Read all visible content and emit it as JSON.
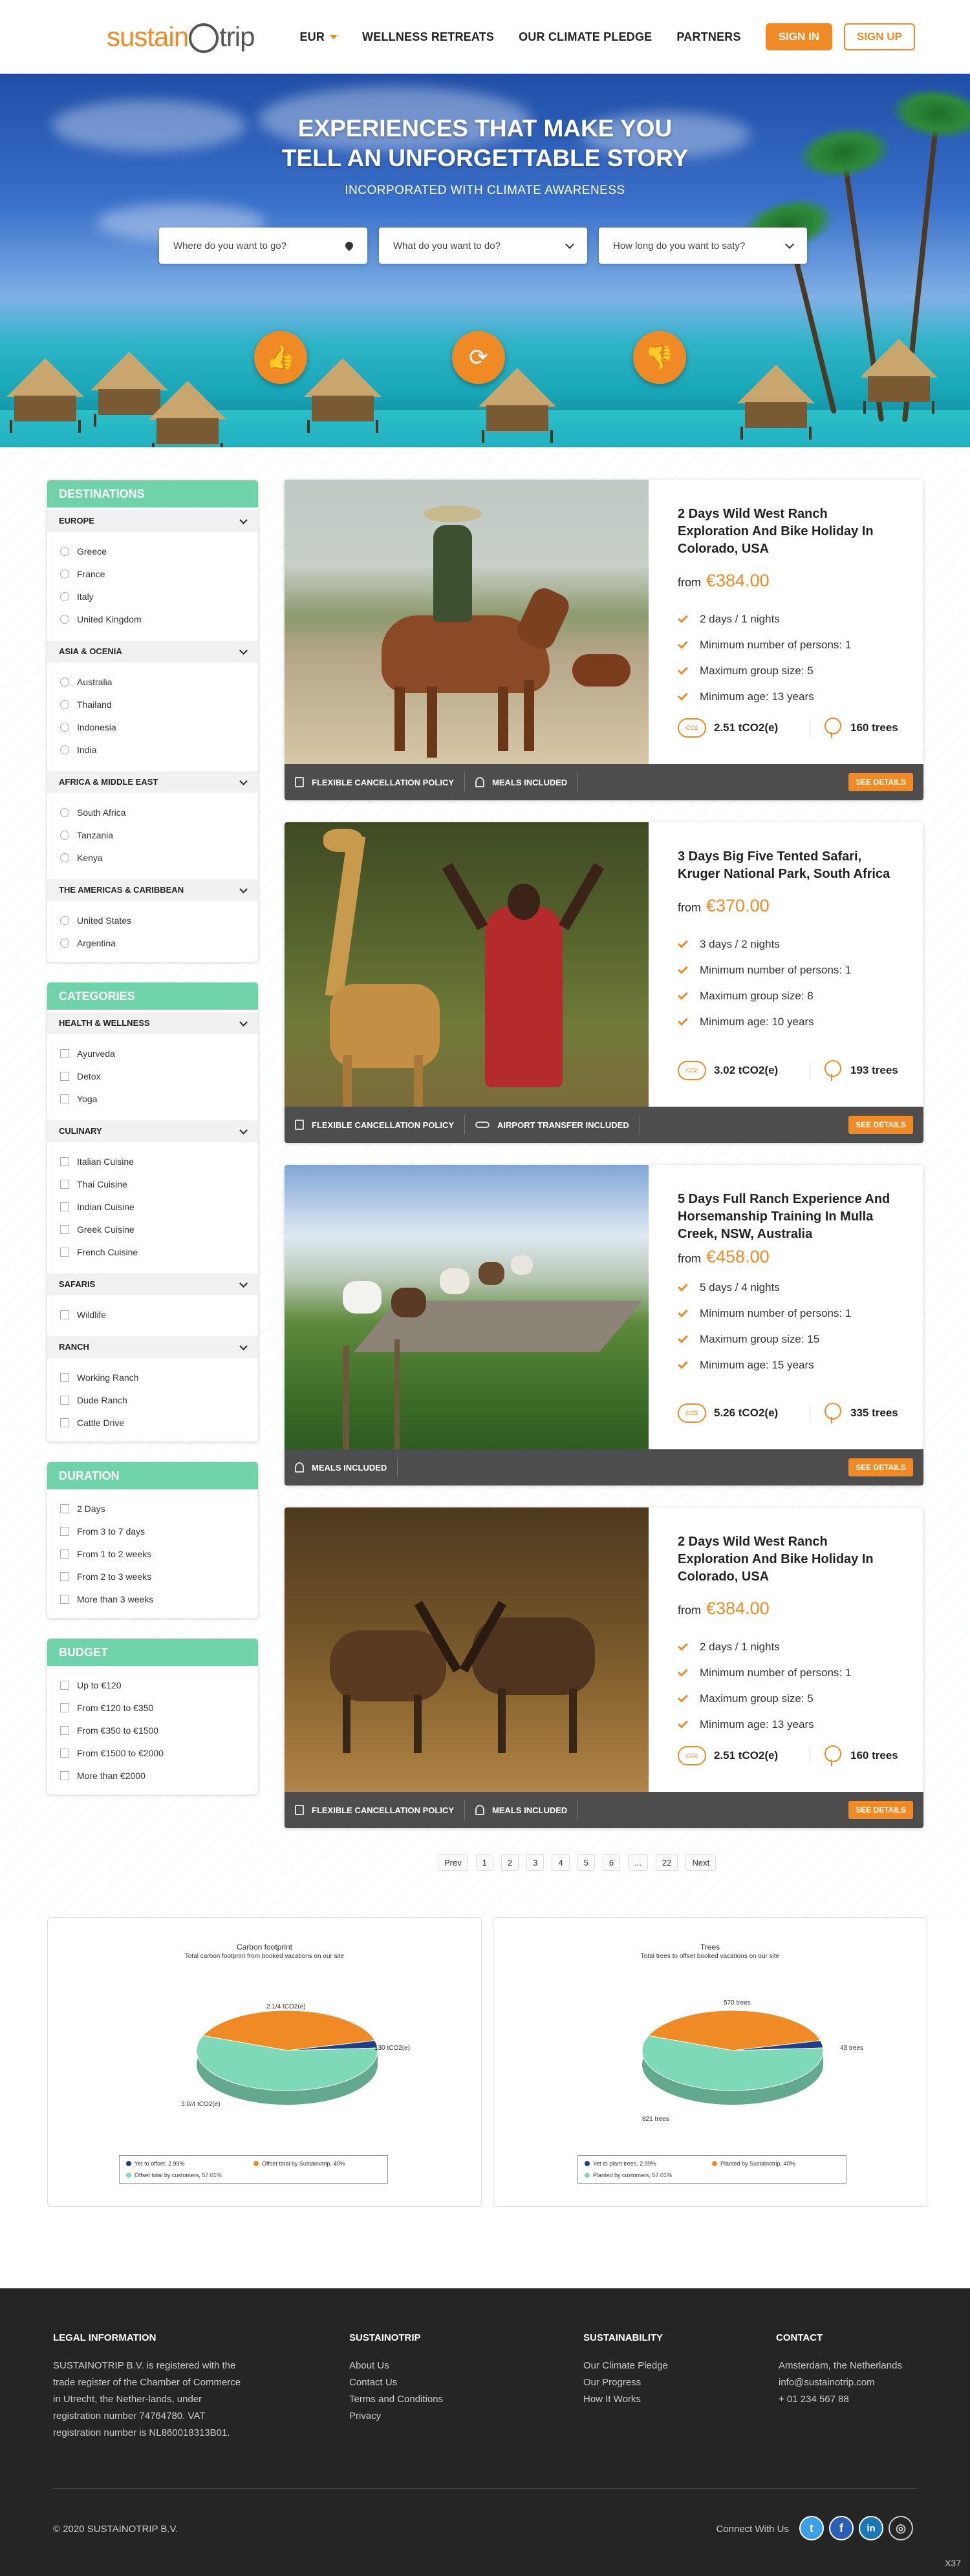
{
  "header": {
    "logo_main": "sustain",
    "logo_trip": "trip",
    "nav": {
      "currency": "EUR",
      "wellness": "WELLNESS RETREATS",
      "pledge": "OUR CLIMATE PLEDGE",
      "partners": "PARTNERS"
    },
    "signin": "SIGN IN",
    "signup": "SIGN UP"
  },
  "hero": {
    "title_line1": "EXPERIENCES THAT MAKE YOU",
    "title_line2": "TELL AN UNFORGETTABLE STORY",
    "subtitle": "INCORPORATED WITH CLIMATE AWARENESS",
    "search": {
      "where": "Where do you want to go?",
      "what": "What do you want to do?",
      "howlong": "How long do you want to saty?"
    }
  },
  "sidebar": {
    "destinations": {
      "title": "DESTINATIONS",
      "groups": [
        {
          "name": "EUROPE",
          "items": [
            "Greece",
            "France",
            "Italy",
            "United Kingdom"
          ]
        },
        {
          "name": "ASIA & OCENIA",
          "items": [
            "Australia",
            "Thailand",
            "Indonesia",
            "India"
          ]
        },
        {
          "name": "AFRICA & MIDDLE EAST",
          "items": [
            "South Africa",
            "Tanzania",
            "Kenya"
          ]
        },
        {
          "name": "THE AMERICAS & CARIBBEAN",
          "items": [
            "United States",
            "Argentina"
          ]
        }
      ]
    },
    "categories": {
      "title": "CATEGORIES",
      "groups": [
        {
          "name": "HEALTH & WELLNESS",
          "items": [
            "Ayurveda",
            "Detox",
            "Yoga"
          ]
        },
        {
          "name": "CULINARY",
          "items": [
            "Italian Cuisine",
            "Thai Cuisine",
            "Indian Cuisine",
            "Greek Cuisine",
            "French Cuisine"
          ]
        },
        {
          "name": "SAFARIS",
          "items": [
            "Wildlife"
          ]
        },
        {
          "name": "RANCH",
          "items": [
            "Working Ranch",
            "Dude Ranch",
            "Cattle Drive"
          ]
        }
      ]
    },
    "duration": {
      "title": "DURATION",
      "items": [
        "2 Days",
        "From 3 to 7 days",
        "From 1 to 2 weeks",
        "From 2 to 3 weeks",
        "More than 3 weeks"
      ]
    },
    "budget": {
      "title": "BUDGET",
      "items": [
        "Up to €120",
        "From €120 to €350",
        "From €350 to €1500",
        "From €1500 to €2000",
        "More than €2000"
      ]
    }
  },
  "cards": [
    {
      "title": "2 Days Wild West Ranch Exploration And Bike Holiday In Colorado, USA",
      "from": "from",
      "price": "€384.00",
      "features": [
        "2 days / 1 nights",
        "Minimum number of persons: 1",
        "Maximum group size: 5",
        "Minimum age: 13 years"
      ],
      "co2": "2.51 tCO2(e)",
      "trees": "160 trees",
      "co2_icon": "CO2",
      "tags": [
        "FLEXIBLE CANCELLATION POLICY",
        "MEALS INCLUDED"
      ],
      "details": "SEE DETAILS"
    },
    {
      "title": "3 Days Big Five Tented Safari, Kruger National Park, South Africa",
      "from": "from",
      "price": "€370.00",
      "features": [
        "3 days / 2 nights",
        "Minimum number of persons: 1",
        "Maximum group size: 8",
        "Minimum age: 10 years"
      ],
      "co2": "3.02 tCO2(e)",
      "trees": "193 trees",
      "co2_icon": "CO2",
      "tags": [
        "FLEXIBLE CANCELLATION POLICY",
        "AIRPORT TRANSFER INCLUDED"
      ],
      "details": "SEE DETAILS"
    },
    {
      "title": "5 Days Full Ranch Experience And Horsemanship Training In Mulla Creek, NSW, Australia",
      "from": "from",
      "price": "€458.00",
      "features": [
        "5 days / 4 nights",
        "Minimum number of persons: 1",
        "Maximum group size: 15",
        "Minimum age: 15 years"
      ],
      "co2": "5.26 tCO2(e)",
      "trees": "335 trees",
      "co2_icon": "CO2",
      "tags": [
        "MEALS INCLUDED"
      ],
      "details": "SEE DETAILS"
    },
    {
      "title": "2 Days Wild West Ranch Exploration And Bike Holiday In Colorado, USA",
      "from": "from",
      "price": "€384.00",
      "features": [
        "2 days / 1 nights",
        "Minimum number of persons: 1",
        "Maximum group size: 5",
        "Minimum age: 13 years"
      ],
      "co2": "2.51 tCO2(e)",
      "trees": "160 trees",
      "co2_icon": "CO2",
      "tags": [
        "FLEXIBLE CANCELLATION POLICY",
        "MEALS INCLUDED"
      ],
      "details": "SEE DETAILS"
    }
  ],
  "pagination": [
    "Prev",
    "1",
    "2",
    "3",
    "4",
    "5",
    "6",
    "...",
    "22",
    "Next"
  ],
  "chart_data": [
    {
      "type": "pie",
      "title": "Carbon footprint",
      "subtitle": "Total carbon footprint from booked vacations on our site",
      "slices": [
        {
          "name": "Yet to offset, 2.99%",
          "label": "130 tCO2(e)",
          "value": 2.99,
          "color": "#1f3f8a"
        },
        {
          "name": "Offset total by Sustainotrip, 40%",
          "label": "2.1/4 tCO2(e)",
          "value": 40,
          "color": "#f08a24"
        },
        {
          "name": "Offset total by customers, 57.01%",
          "label": "3.0/4 tCO2(e)",
          "value": 57.01,
          "color": "#7ed9b6"
        }
      ]
    },
    {
      "type": "pie",
      "title": "Trees",
      "subtitle": "Total trees to offset booked vacations on our site",
      "slices": [
        {
          "name": "Yet to plant trees, 2.99%",
          "label": "43 trees",
          "value": 2.99,
          "color": "#1f3f8a"
        },
        {
          "name": "Planted by Sustainotrip, 40%",
          "label": "570 trees",
          "value": 40,
          "color": "#f08a24"
        },
        {
          "name": "Planted by customers, 57.01%",
          "label": "821 trees",
          "value": 57.01,
          "color": "#7ed9b6"
        }
      ]
    }
  ],
  "footer": {
    "legal_title": "LEGAL INFORMATION",
    "legal_text": "SUSTAINOTRIP B.V. is registered with the trade register of the Chamber of Commerce in Utrecht, the Nether-lands, under registration number 74764780. VAT registration number is NL860018313B01.",
    "sust_title": "SUSTAINOTRIP",
    "sust_links": [
      "About Us",
      "Contact Us",
      "Terms and Conditions",
      "Privacy"
    ],
    "sus_title": "SUSTAINABILITY",
    "sus_links": [
      "Our Climate Pledge",
      "Our Progress",
      "How It Works"
    ],
    "contact_title": "CONTACT",
    "contact": [
      "Amsterdam, the Netherlands",
      "info@sustainotrip.com",
      "+ 01 234 567 88"
    ],
    "copyright": "© 2020 SUSTAINOTRIP B.V.",
    "connect": "Connect With Us",
    "badge": "X37"
  }
}
